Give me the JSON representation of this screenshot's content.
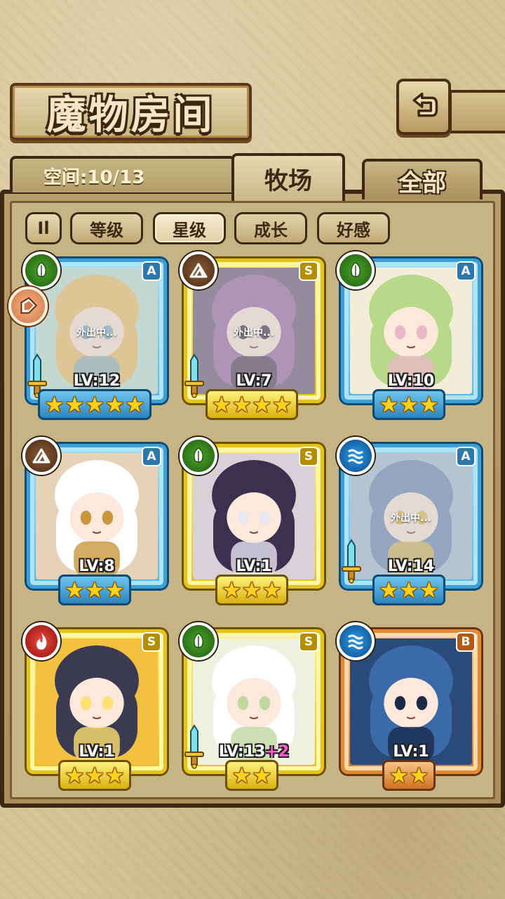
{
  "header": {
    "title": "魔物房间",
    "capacity": "空间:10/13"
  },
  "tabs": [
    {
      "label": "牧场",
      "active": true
    },
    {
      "label": "全部",
      "active": false
    }
  ],
  "filters": {
    "toggle_label": "Il",
    "items": [
      {
        "label": "等级",
        "active": false
      },
      {
        "label": "星级",
        "active": true
      },
      {
        "label": "成长",
        "active": false
      },
      {
        "label": "好感",
        "active": false
      }
    ]
  },
  "monsters": [
    {
      "level": "LV:12",
      "plus": "",
      "rank": "A",
      "element": "grass",
      "stars": "★★★★★",
      "frame": "blue",
      "away": "外出中...",
      "sword": true
    },
    {
      "level": "LV:7",
      "plus": "",
      "rank": "S",
      "element": "earth",
      "stars": "★★★★",
      "frame": "gold",
      "away": "外出中...",
      "sword": true
    },
    {
      "level": "LV:10",
      "plus": "",
      "rank": "A",
      "element": "grass",
      "stars": "★★★",
      "frame": "blue",
      "away": "",
      "sword": false
    },
    {
      "level": "LV:8",
      "plus": "",
      "rank": "A",
      "element": "earth",
      "stars": "★★★",
      "frame": "blue",
      "away": "",
      "sword": false
    },
    {
      "level": "LV:1",
      "plus": "",
      "rank": "S",
      "element": "grass",
      "stars": "★★★",
      "frame": "gold",
      "away": "",
      "sword": false
    },
    {
      "level": "LV:14",
      "plus": "",
      "rank": "A",
      "element": "water",
      "stars": "★★★",
      "frame": "blue",
      "away": "外出中...",
      "sword": true
    },
    {
      "level": "LV:1",
      "plus": "",
      "rank": "S",
      "element": "fire",
      "stars": "★★★",
      "frame": "gold",
      "away": "",
      "sword": false
    },
    {
      "level": "LV:13",
      "plus": "+2",
      "rank": "S",
      "element": "grass",
      "stars": "★★",
      "frame": "gold",
      "away": "",
      "sword": true
    },
    {
      "level": "LV:1",
      "plus": "",
      "rank": "B",
      "element": "water",
      "stars": "★★",
      "frame": "orange",
      "away": "",
      "sword": false
    }
  ],
  "colors": {
    "frame_blue": "#3c9fd6",
    "frame_gold": "#e5c318",
    "frame_orange": "#e48a36",
    "panel": "#b79f6c"
  }
}
